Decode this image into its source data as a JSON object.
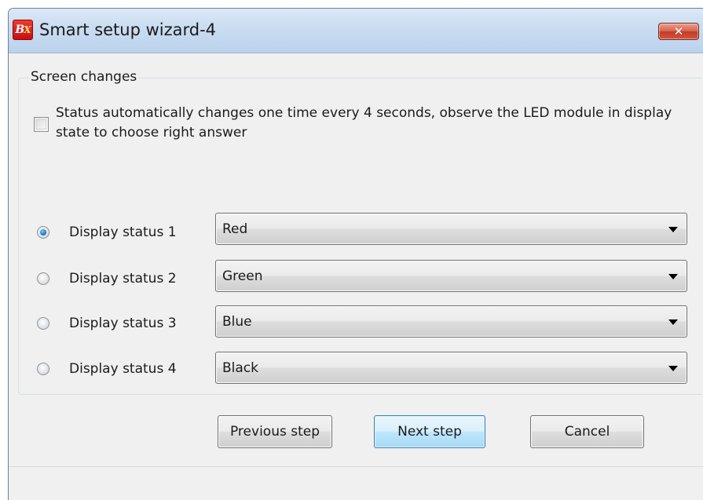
{
  "window": {
    "title": "Smart setup wizard-4",
    "logo_text_b": "B",
    "logo_text_x": "X",
    "close_glyph": "✕",
    "accent_color": "#3c7fb1",
    "close_color": "#c43b25"
  },
  "group": {
    "legend": "Screen changes",
    "auto_change_checked": false,
    "auto_change_label": "Status automatically changes one time every 4 seconds, observe the LED module in display state to choose right answer",
    "rows": [
      {
        "label": "Display status 1",
        "selected": true,
        "value": "Red"
      },
      {
        "label": "Display status 2",
        "selected": false,
        "value": "Green"
      },
      {
        "label": "Display status 3",
        "selected": false,
        "value": "Blue"
      },
      {
        "label": "Display status 4",
        "selected": false,
        "value": "Black"
      }
    ]
  },
  "buttons": {
    "previous": "Previous step",
    "next": "Next step",
    "cancel": "Cancel"
  },
  "icons": {
    "app": "bx-logo-icon",
    "close": "close-icon",
    "dropdown": "chevron-down-icon"
  }
}
